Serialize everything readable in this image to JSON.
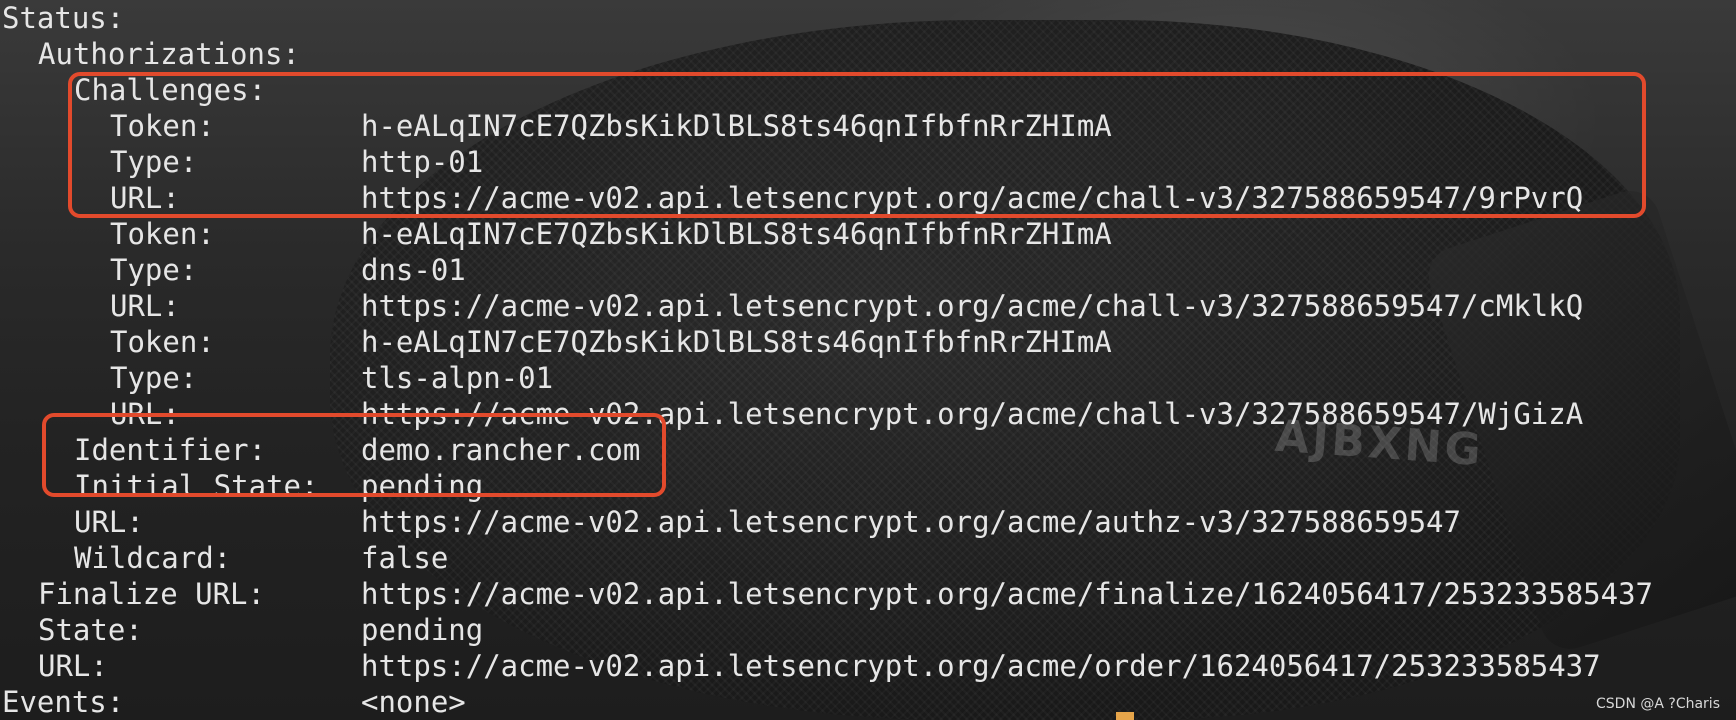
{
  "status_label": "Status:",
  "authorizations_label": "Authorizations:",
  "challenges_label": "Challenges:",
  "challenges": [
    {
      "token_label": "Token:",
      "token": "h-eALqIN7cE7QZbsKikDlBLS8ts46qnIfbfnRrZHImA",
      "type_label": "Type:",
      "type": "http-01",
      "url_label": "URL:",
      "url": "https://acme-v02.api.letsencrypt.org/acme/chall-v3/327588659547/9rPvrQ"
    },
    {
      "token_label": "Token:",
      "token": "h-eALqIN7cE7QZbsKikDlBLS8ts46qnIfbfnRrZHImA",
      "type_label": "Type:",
      "type": "dns-01",
      "url_label": "URL:",
      "url": "https://acme-v02.api.letsencrypt.org/acme/chall-v3/327588659547/cMklkQ"
    },
    {
      "token_label": "Token:",
      "token": "h-eALqIN7cE7QZbsKikDlBLS8ts46qnIfbfnRrZHImA",
      "type_label": "Type:",
      "type": "tls-alpn-01",
      "url_label": "URL:",
      "url": "https://acme-v02.api.letsencrypt.org/acme/chall-v3/327588659547/WjGizA"
    }
  ],
  "authorization": {
    "identifier_label": "Identifier:",
    "identifier": "demo.rancher.com",
    "initial_state_label": "Initial State:",
    "initial_state": "pending",
    "url_label": "URL:",
    "url": "https://acme-v02.api.letsencrypt.org/acme/authz-v3/327588659547",
    "wildcard_label": "Wildcard:",
    "wildcard": "false"
  },
  "finalize_url_label": "Finalize URL:",
  "finalize_url": "https://acme-v02.api.letsencrypt.org/acme/finalize/1624056417/253233585437",
  "state_label": "State:",
  "state": "pending",
  "order_url_label": "URL:",
  "order_url": "https://acme-v02.api.letsencrypt.org/acme/order/1624056417/253233585437",
  "events_label": "Events:",
  "events": "<none>",
  "watermark": "CSDN @A ?Charis",
  "colors": {
    "highlight_border": "#e24a2c",
    "text": "#e6e6e6"
  }
}
